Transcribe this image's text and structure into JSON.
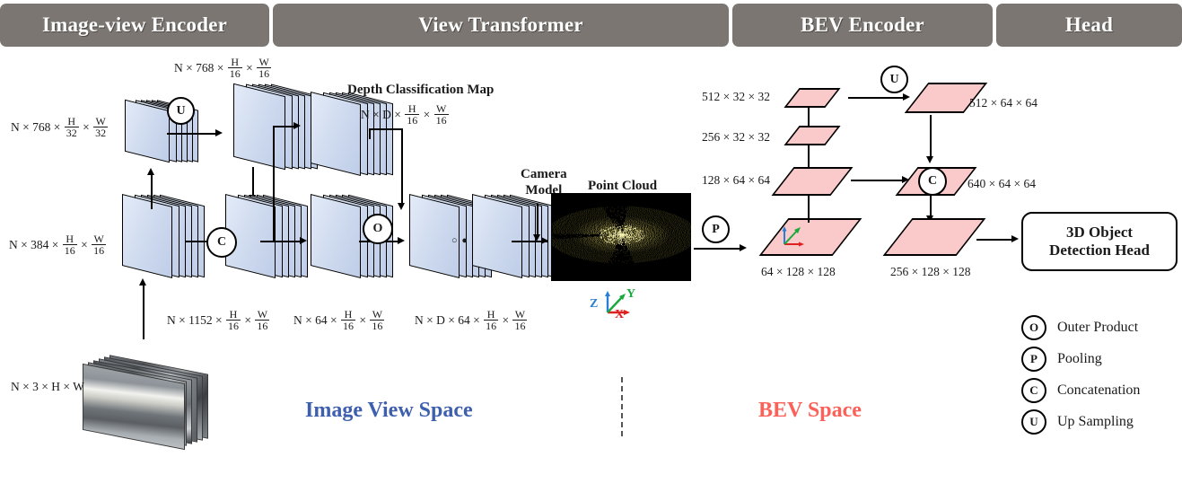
{
  "header": {
    "sections": [
      {
        "label": "Image-view Encoder"
      },
      {
        "label": "View Transformer"
      },
      {
        "label": "BEV Encoder"
      },
      {
        "label": "Head"
      }
    ]
  },
  "image_view_encoder": {
    "input_shape": {
      "prefix": "N × 3 × H × W"
    },
    "feat_384": {
      "prefix": "N × 384 ×",
      "num1": "H",
      "den1": "16",
      "num2": "W",
      "den2": "16"
    },
    "feat_768_32": {
      "prefix": "N × 768 ×",
      "num1": "H",
      "den1": "32",
      "num2": "W",
      "den2": "32"
    },
    "feat_768_16": {
      "prefix": "N × 768 ×",
      "num1": "H",
      "den1": "16",
      "num2": "W",
      "den2": "16"
    },
    "feat_1152": {
      "prefix": "N × 1152 ×",
      "num1": "H",
      "den1": "16",
      "num2": "W",
      "den2": "16"
    },
    "up_op": "U",
    "concat_op": "C"
  },
  "view_transformer": {
    "depth_map_title": "Depth Classification Map",
    "depth_map_shape": {
      "prefix": "N × D ×",
      "num1": "H",
      "den1": "16",
      "num2": "W",
      "den2": "16"
    },
    "feat_64": {
      "prefix": "N × 64 ×",
      "num1": "H",
      "den1": "16",
      "num2": "W",
      "den2": "16"
    },
    "feat_d64": {
      "prefix": "N × D × 64 ×",
      "num1": "H",
      "den1": "16",
      "num2": "W",
      "den2": "16"
    },
    "outer_product_op": "O",
    "camera_model_label_line1": "Camera",
    "camera_model_label_line2": "Model",
    "point_cloud_title": "Point Cloud",
    "axes": {
      "z": "Z",
      "y": "Y",
      "x": "X"
    },
    "pooling_op": "P",
    "ellipsis": "○ ● ○"
  },
  "bev_encoder": {
    "shape_512_32": "512 × 32 × 32",
    "shape_256_32": "256 × 32 × 32",
    "shape_128_64": "128 × 64 × 64",
    "shape_64_128": "64 × 128 × 128",
    "shape_512_64": "512 × 64 × 64",
    "shape_640_64": "640 × 64 × 64",
    "shape_256_128": "256 × 128 × 128",
    "up_op": "U",
    "concat_op": "C"
  },
  "head": {
    "title_line1": "3D Object",
    "title_line2": "Detection Head"
  },
  "spaces": {
    "image_view": "Image View Space",
    "bev": "BEV Space"
  },
  "legend": {
    "items": [
      {
        "symbol": "O",
        "label": "Outer Product"
      },
      {
        "symbol": "P",
        "label": "Pooling"
      },
      {
        "symbol": "C",
        "label": "Concatenation"
      },
      {
        "symbol": "U",
        "label": "Up Sampling"
      }
    ]
  },
  "colors": {
    "header_gray": "#7b7671",
    "feature_blue": "#cdd9ee",
    "bev_pink": "#fac9c9",
    "image_view_space_text": "#3e5fae",
    "bev_space_text": "#fb6158",
    "point_cloud_points": "#ece06a",
    "point_cloud_bg": "#000000"
  }
}
